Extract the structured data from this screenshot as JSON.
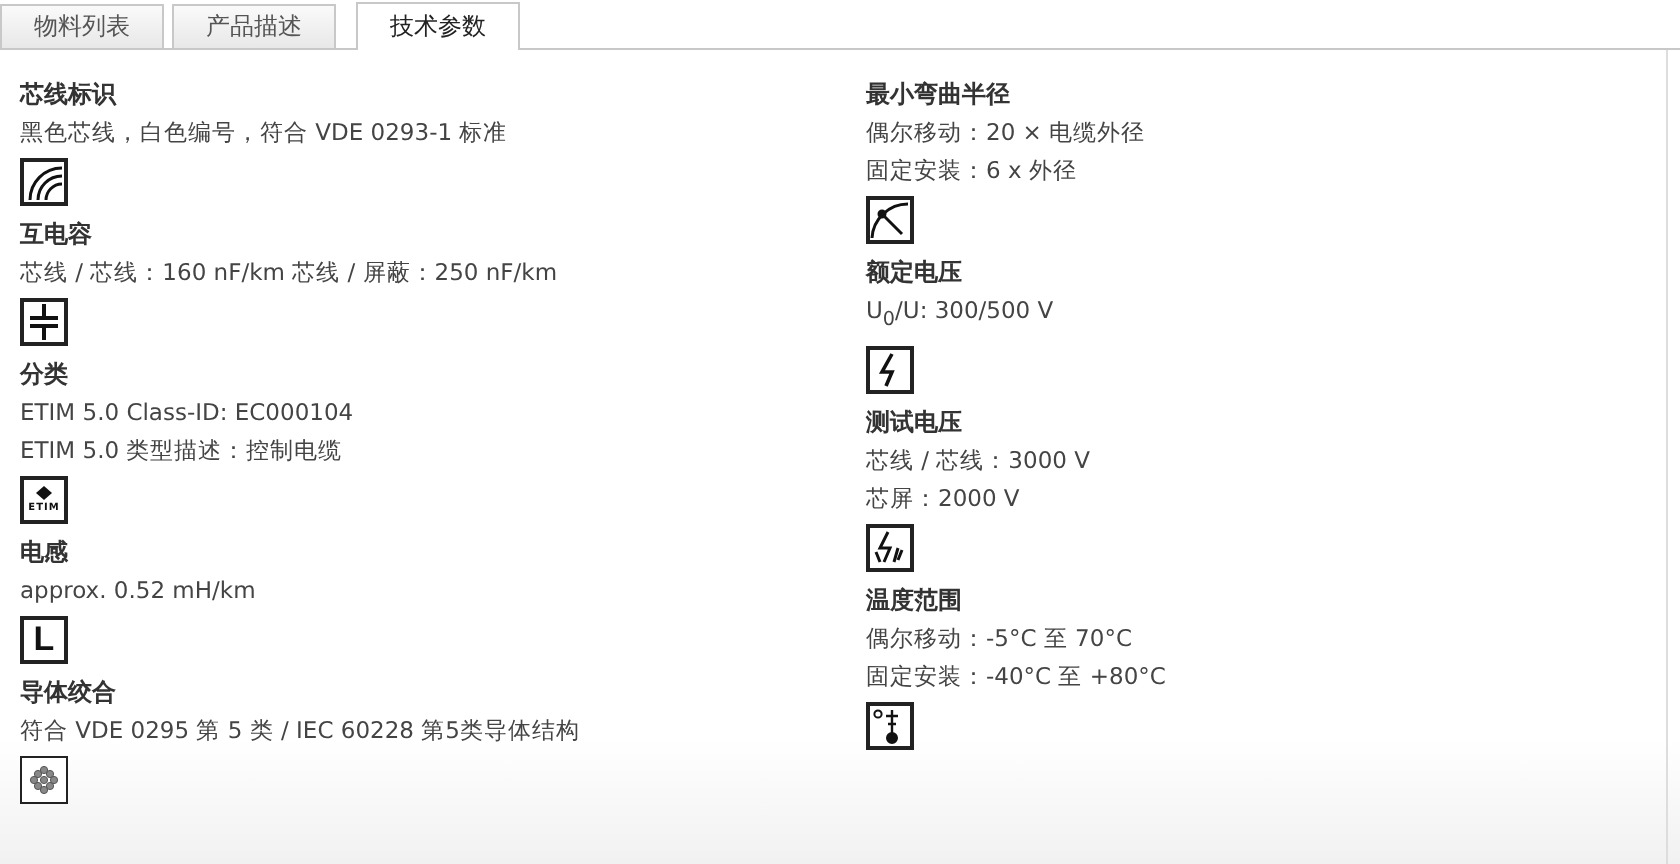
{
  "tabs": [
    {
      "label": "物料列表",
      "selected": false
    },
    {
      "label": "产品描述",
      "selected": false
    },
    {
      "label": "技术参数",
      "selected": true
    }
  ],
  "columns": [
    {
      "sections": [
        {
          "title": "芯线标识",
          "lines": [
            "黑色芯线，白色编号，符合 VDE 0293-1 标准"
          ],
          "icon": {
            "kind": "cores"
          }
        },
        {
          "title": "互电容",
          "lines": [
            "芯线 / 芯线：160 nF/km 芯线 / 屏蔽：250 nF/km"
          ],
          "icon": {
            "kind": "capacitor"
          }
        },
        {
          "title": "分类",
          "lines": [
            "ETIM 5.0 Class-ID: EC000104",
            "ETIM 5.0 类型描述：控制电缆"
          ],
          "icon": {
            "kind": "etim",
            "label": "ETIM"
          }
        },
        {
          "title": "电感",
          "lines": [
            "approx. 0.52 mH/km"
          ],
          "icon": {
            "kind": "letter",
            "label": "L"
          }
        },
        {
          "title": "导体绞合",
          "lines": [
            "符合 VDE 0295 第 5 类 / IEC 60228 第5类导体结构"
          ],
          "icon": {
            "kind": "strands"
          }
        }
      ]
    },
    {
      "sections": [
        {
          "title": "最小弯曲半径",
          "lines": [
            "偶尔移动：20 × 电缆外径",
            "固定安装：6 x 外径"
          ],
          "icon": {
            "kind": "bend"
          }
        },
        {
          "title": "额定电压",
          "lines": [
            "U$_{0}$/U: 300/500 V"
          ],
          "icon": {
            "kind": "lightning"
          }
        },
        {
          "title": "测试电压",
          "lines": [
            "芯线 / 芯线：3000 V",
            "芯屏：2000 V"
          ],
          "icon": {
            "kind": "test"
          }
        },
        {
          "title": "温度范围",
          "lines": [
            "偶尔移动：-5°C 至 70°C",
            "固定安装：-40°C 至 +80°C"
          ],
          "icon": {
            "kind": "thermometer"
          }
        }
      ]
    }
  ]
}
